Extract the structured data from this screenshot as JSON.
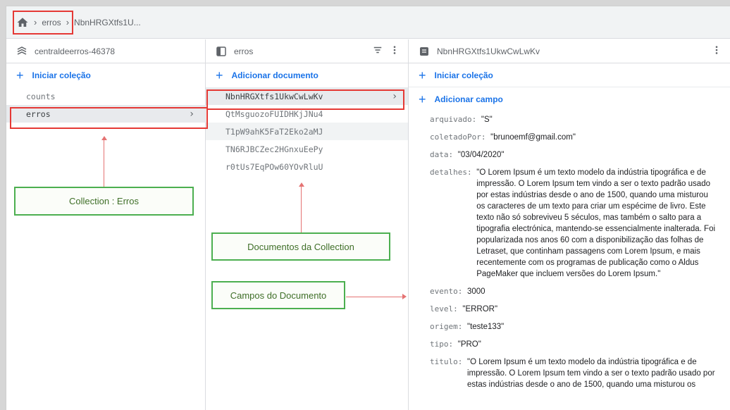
{
  "breadcrumb": {
    "items": [
      "erros",
      "NbnHRGXtfs1U..."
    ]
  },
  "col1": {
    "header": "centraldeerros-46378",
    "add_label": "Iniciar coleção",
    "items": [
      {
        "label": "counts"
      },
      {
        "label": "erros"
      }
    ]
  },
  "col2": {
    "header": "erros",
    "add_label": "Adicionar documento",
    "items": [
      {
        "label": "NbnHRGXtfs1UkwCwLwKv"
      },
      {
        "label": "QtMsguozoFUIDHKjJNu4"
      },
      {
        "label": "T1pW9ahK5FaT2Eko2aMJ"
      },
      {
        "label": "TN6RJBCZec2HGnxuEePy"
      },
      {
        "label": "r0tUs7EqPOw60YOvRluU"
      }
    ]
  },
  "col3": {
    "header": "NbnHRGXtfs1UkwCwLwKv",
    "add_collection_label": "Iniciar coleção",
    "add_field_label": "Adicionar campo",
    "fields": [
      {
        "key": "arquivado:",
        "value": "\"S\""
      },
      {
        "key": "coletadoPor:",
        "value": "\"brunoemf@gmail.com\""
      },
      {
        "key": "data:",
        "value": "\"03/04/2020\""
      },
      {
        "key": "detalhes:",
        "value": "\"O Lorem Ipsum é um texto modelo da indústria tipográfica e de impressão. O Lorem Ipsum tem vindo a ser o texto padrão usado por estas indústrias desde o ano de 1500, quando uma misturou os caracteres de um texto para criar um espécime de livro. Este texto não só sobreviveu 5 séculos, mas também o salto para a tipografia electrónica, mantendo-se essencialmente inalterada. Foi popularizada nos anos 60 com a disponibilização das folhas de Letraset, que continham passagens com Lorem Ipsum, e mais recentemente com os programas de publicação como o Aldus PageMaker que incluem versões do Lorem Ipsum.\""
      },
      {
        "key": "evento:",
        "value": "3000"
      },
      {
        "key": "level:",
        "value": "\"ERROR\""
      },
      {
        "key": "origem:",
        "value": "\"teste133\""
      },
      {
        "key": "tipo:",
        "value": "\"PRO\""
      },
      {
        "key": "titulo:",
        "value": "\"O Lorem Ipsum é um texto modelo da indústria tipográfica e de impressão. O Lorem Ipsum tem vindo a ser o texto padrão usado por estas indústrias desde o ano de 1500, quando uma misturou os"
      }
    ]
  },
  "annotations": {
    "collection": "Collection : Erros",
    "documents": "Documentos da Collection",
    "fields": "Campos do Documento"
  },
  "colors": {
    "accent": "#1a73e8",
    "annotation_red": "#e53935",
    "annotation_green": "#4caf50"
  }
}
